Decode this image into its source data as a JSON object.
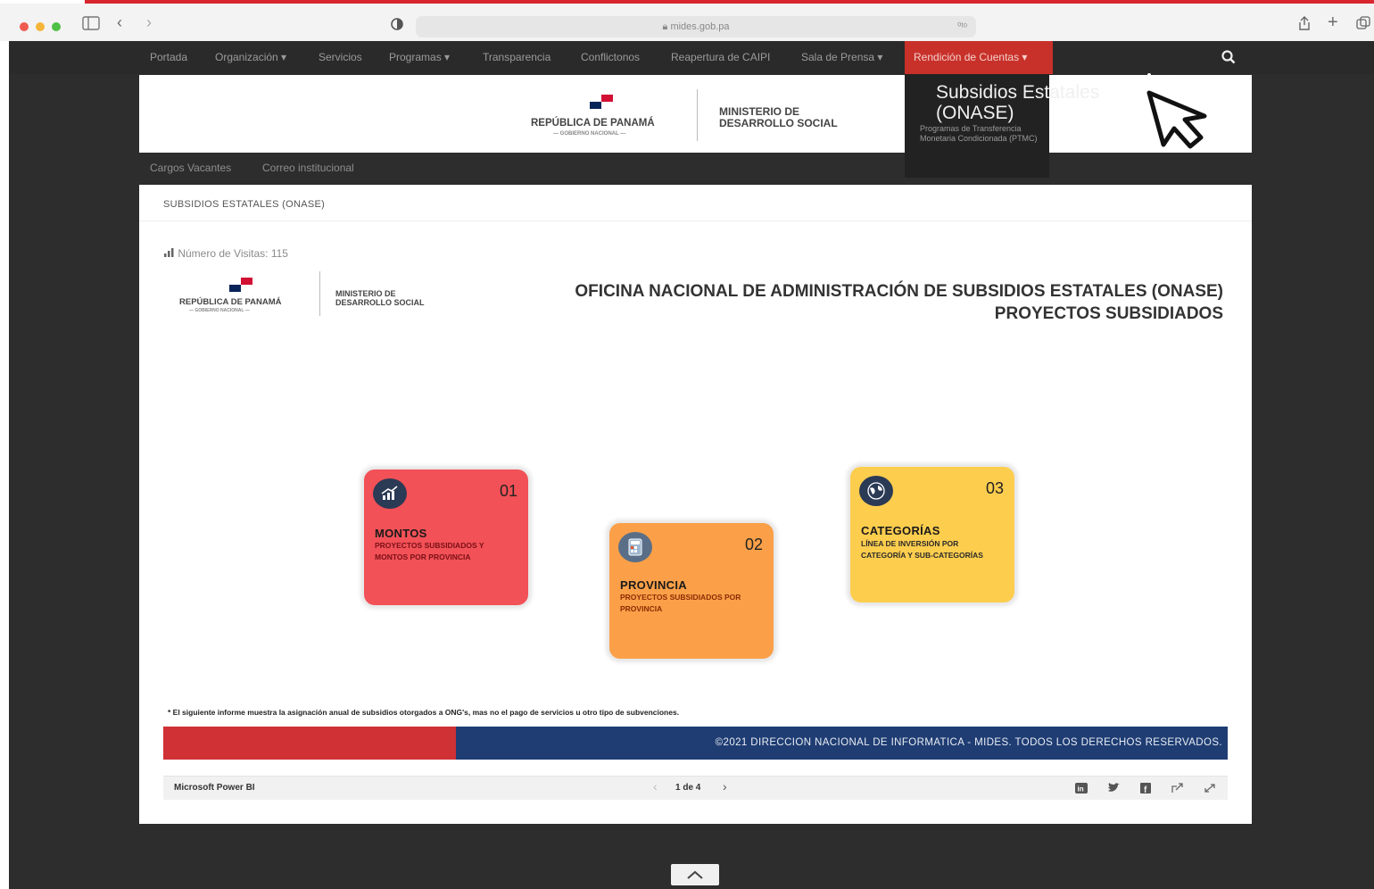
{
  "browser": {
    "url": "mides.gob.pa",
    "right_label": "⁰ᵗᵒ"
  },
  "nav": {
    "items": [
      "Portada",
      "Organización ▾",
      "Servicios",
      "Programas ▾",
      "Transparencia",
      "Conflictonos",
      "Reapertura de CAIPI",
      "Sala de Prensa ▾"
    ],
    "active": "Rendición de Cuentas ▾"
  },
  "dropdown": {
    "title_line1": "Subsidios Estatales",
    "title_line2": "(ONASE)",
    "sub": "Programas de Transferencia Monetaria Condicionada (PTMC)"
  },
  "header": {
    "republic": "REPÚBLICA DE PANAMÁ",
    "gobierno": "— GOBIERNO NACIONAL —",
    "ministry_line1": "MINISTERIO DE",
    "ministry_line2": "DESARROLLO SOCIAL"
  },
  "secnav": [
    "Cargos Vacantes",
    "Correo institucional"
  ],
  "content": {
    "breadcrumb": "SUBSIDIOS ESTATALES (ONASE)",
    "visits": "Número de Visitas: 115",
    "title_line1": "OFICINA NACIONAL DE ADMINISTRACIÓN DE SUBSIDIOS ESTATALES (ONASE)",
    "title_line2": "PROYECTOS SUBSIDIADOS",
    "cards": [
      {
        "num": "01",
        "title": "MONTOS",
        "sub": "PROYECTOS SUBSIDIADOS Y MONTOS POR PROVINCIA",
        "color": "#f25157",
        "icon": "chart-up-icon"
      },
      {
        "num": "02",
        "title": "PROVINCIA",
        "sub": "PROYECTOS SUBSIDIADOS POR PROVINCIA",
        "color": "#fba048",
        "icon": "calculator-icon"
      },
      {
        "num": "03",
        "title": "CATEGORÍAS",
        "sub": "LÍNEA DE INVERSIÓN POR CATEGORÍA Y SUB-CATEGORÍAS",
        "color": "#fdcd4e",
        "icon": "globe-icon"
      }
    ],
    "note": "* El siguiente informe muestra la asignación anual de subsidios otorgados a ONG's, mas no el pago de servicios u otro tipo de subvenciones.",
    "copyright": "©2021 DIRECCION NACIONAL DE INFORMATICA - MIDES.  TODOS LOS DERECHOS RESERVADOS.",
    "powerbi": "Microsoft Power BI",
    "page": "1 de 4"
  },
  "colors": {
    "accent_red": "#c8312a",
    "footer_blue": "#1f3d73",
    "icon_circle": "#2b3a55"
  }
}
